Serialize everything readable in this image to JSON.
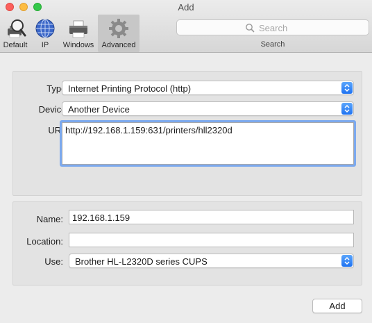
{
  "window": {
    "title": "Add"
  },
  "toolbar": {
    "items": [
      {
        "label": "Default",
        "icon": "default-printer-icon"
      },
      {
        "label": "IP",
        "icon": "globe-icon"
      },
      {
        "label": "Windows",
        "icon": "windows-printer-icon"
      },
      {
        "label": "Advanced",
        "icon": "gear-icon",
        "selected": true
      }
    ],
    "search": {
      "placeholder": "Search",
      "caption": "Search"
    }
  },
  "connection": {
    "type": {
      "label": "Type:",
      "value": "Internet Printing Protocol (http)"
    },
    "device": {
      "label": "Device:",
      "value": "Another Device"
    },
    "url": {
      "label": "URL:",
      "value": "http://192.168.1.159:631/printers/hll2320d"
    }
  },
  "printer": {
    "name": {
      "label": "Name:",
      "value": "192.168.1.159"
    },
    "location": {
      "label": "Location:",
      "value": ""
    },
    "use": {
      "label": "Use:",
      "value": "Brother HL-L2320D series CUPS"
    }
  },
  "actions": {
    "add_label": "Add"
  },
  "colors": {
    "accent": "#1f72f1",
    "focus_ring": "#7ca9ee",
    "close": "#fc605c",
    "minimize": "#fdbc40",
    "maximize": "#34c84a"
  }
}
